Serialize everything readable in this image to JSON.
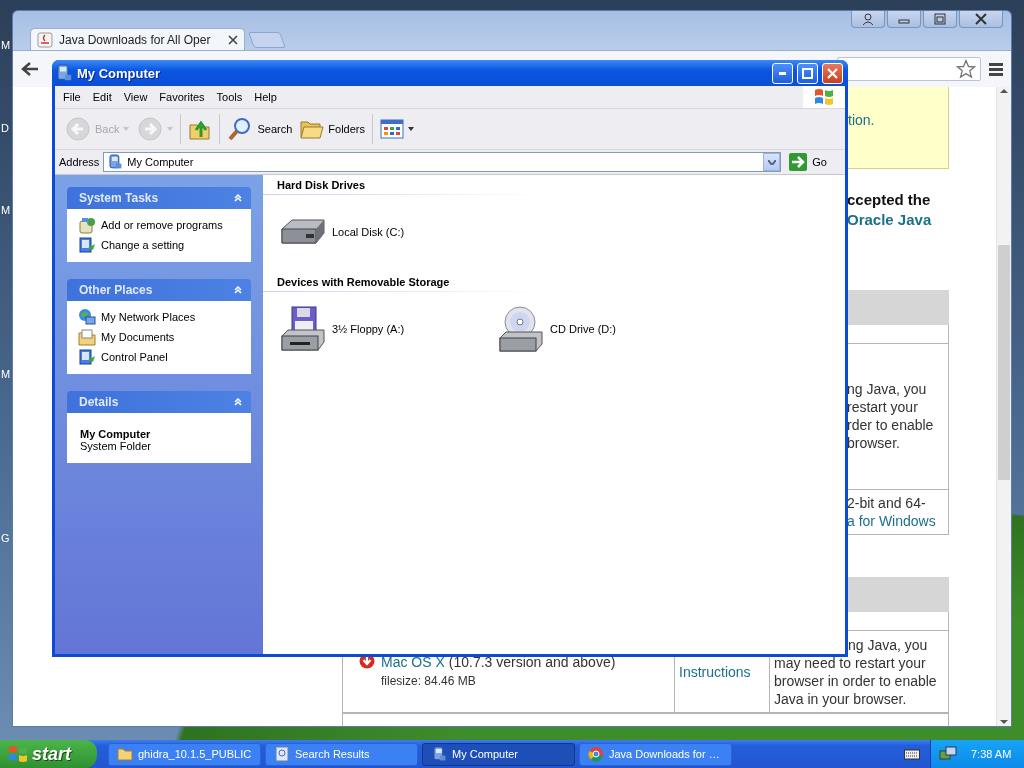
{
  "desktop": {
    "icon_labels": [
      "M",
      "D",
      "M",
      "M",
      "G"
    ]
  },
  "browser": {
    "tabs": [
      {
        "title": "Java Downloads for All Oper",
        "selected": true
      }
    ],
    "page": {
      "notice": "tion.",
      "heading": [
        {
          "text": "ccepted the",
          "kind": "plain"
        },
        {
          "text": "Oracle Java",
          "kind": "link"
        }
      ],
      "sections": [
        {
          "rows": [
            {},
            {
              "lines": [
                {
                  "text": "ng Java, you",
                  "kind": "plain"
                },
                {
                  "text": "restart your",
                  "kind": "plain"
                },
                {
                  "text": "rder to enable",
                  "kind": "plain"
                },
                {
                  "text": "browser.",
                  "kind": "plain"
                }
              ]
            },
            {
              "lines": [
                {
                  "text": "2-bit and 64-",
                  "kind": "plain"
                },
                {
                  "text": "a for Windows",
                  "kind": "link"
                }
              ]
            }
          ]
        },
        {
          "rows": [
            {},
            {
              "download": {
                "os": "Mac OS X",
                "os_note": "(10.7.3 version and above)",
                "filesize": "filesize: 84.46 MB",
                "instructions": "Instructions"
              },
              "lines": [
                {
                  "text": "ng Java, you",
                  "kind": "partial"
                },
                {
                  "text": "may need to restart your",
                  "kind": "plain"
                },
                {
                  "text": "browser in order to enable",
                  "kind": "plain"
                },
                {
                  "text": "Java in your browser.",
                  "kind": "plain"
                }
              ]
            }
          ]
        }
      ]
    }
  },
  "explorer": {
    "title": "My Computer",
    "menu": [
      "File",
      "Edit",
      "View",
      "Favorites",
      "Tools",
      "Help"
    ],
    "toolbar": [
      {
        "kind": "back",
        "label": "Back",
        "disabled": true
      },
      {
        "kind": "forward",
        "disabled": true
      },
      {
        "kind": "up",
        "disabled": false
      },
      {
        "kind": "search",
        "label": "Search",
        "disabled": false
      },
      {
        "kind": "folders",
        "label": "Folders",
        "disabled": false
      },
      {
        "kind": "views",
        "disabled": false
      }
    ],
    "address": {
      "label": "Address",
      "value": "My Computer",
      "go": "Go"
    },
    "panels": [
      {
        "title": "System Tasks",
        "expanded": true,
        "items": [
          {
            "label": "Add or remove programs",
            "kind": "programs"
          },
          {
            "label": "Change a setting",
            "kind": "control"
          }
        ]
      },
      {
        "title": "Other Places",
        "expanded": true,
        "items": [
          {
            "label": "My Network Places",
            "kind": "network"
          },
          {
            "label": "My Documents",
            "kind": "documents"
          },
          {
            "label": "Control Panel",
            "kind": "control"
          }
        ]
      },
      {
        "title": "Details",
        "expanded": true,
        "details": {
          "name": "My Computer",
          "type": "System Folder"
        }
      }
    ],
    "groups": [
      {
        "title": "Hard Disk Drives",
        "items": [
          {
            "label": "Local Disk (C:)",
            "kind": "hdd"
          }
        ]
      },
      {
        "title": "Devices with Removable Storage",
        "items": [
          {
            "label": "3½ Floppy (A:)",
            "kind": "floppy"
          },
          {
            "label": "CD Drive (D:)",
            "kind": "cd"
          }
        ]
      }
    ]
  },
  "taskbar": {
    "start": "start",
    "tasks": [
      {
        "label": "ghidra_10.1.5_PUBLIC",
        "kind": "folder",
        "selected": false
      },
      {
        "label": "Search Results",
        "kind": "search",
        "selected": false
      },
      {
        "label": "My Computer",
        "kind": "computer",
        "selected": true
      },
      {
        "label": "Java Downloads for …",
        "kind": "chrome",
        "selected": false
      }
    ],
    "clock": "7:38 AM"
  }
}
